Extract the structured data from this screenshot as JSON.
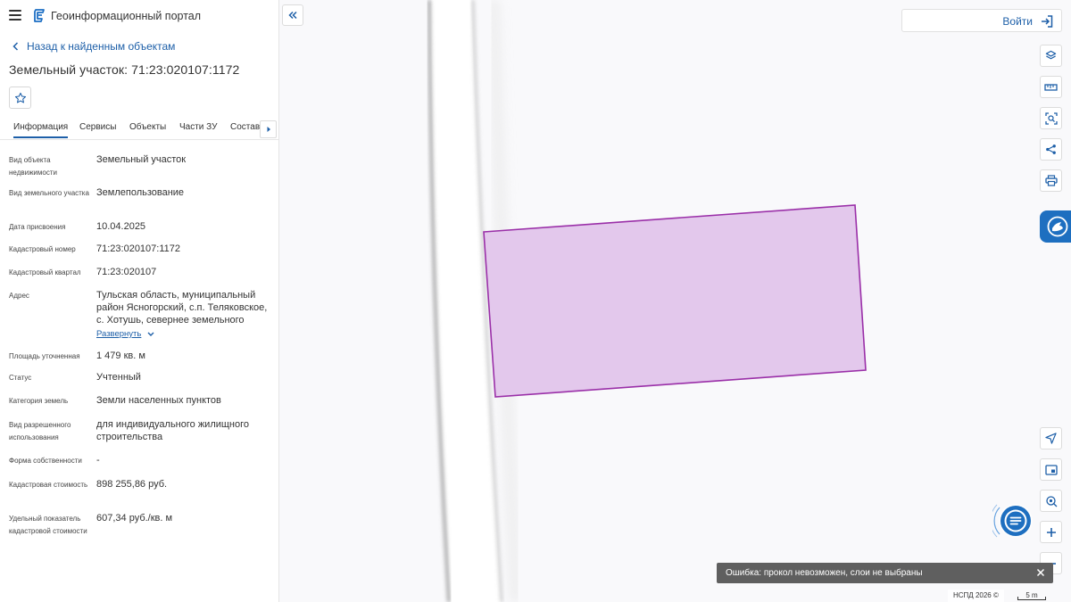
{
  "app": {
    "title": "Геоинформационный портал"
  },
  "nav": {
    "back_label": "Назад к найденным объектам"
  },
  "object": {
    "title": "Земельный участок: 71:23:020107:1172"
  },
  "tabs": [
    {
      "label": "Информация",
      "active": true
    },
    {
      "label": "Сервисы",
      "active": false
    },
    {
      "label": "Объекты",
      "active": false
    },
    {
      "label": "Части ЗУ",
      "active": false
    },
    {
      "label": "Состав",
      "active": false
    }
  ],
  "fields": [
    {
      "label": "Вид объекта недвижимости",
      "value": "Земельный участок"
    },
    {
      "label": "Вид земельного участка",
      "value": "Землепользование"
    },
    {
      "label": "Дата присвоения",
      "value": "10.04.2025"
    },
    {
      "label": "Кадастровый номер",
      "value": "71:23:020107:1172"
    },
    {
      "label": "Кадастровый квартал",
      "value": "71:23:020107"
    },
    {
      "label": "Адрес",
      "value": "Тульская область, муниципальный район Ясногорский, с.п. Теляковское, с. Хотушь, севернее земельного"
    },
    {
      "label": "Площадь уточненная",
      "value": "1 479 кв. м"
    },
    {
      "label": "Статус",
      "value": "Учтенный"
    },
    {
      "label": "Категория земель",
      "value": "Земли населенных пунктов"
    },
    {
      "label": "Вид разрешенного использования",
      "value": "для индивидуального жилищного строительства"
    },
    {
      "label": "Форма собственности",
      "value": "-"
    },
    {
      "label": "Кадастровая стоимость",
      "value": "898 255,86 руб."
    },
    {
      "label": "Удельный показатель кадастровой стоимости",
      "value": "607,34 руб./кв. м"
    }
  ],
  "address_expand_label": "Развернуть",
  "header": {
    "login_label": "Войти"
  },
  "toast": {
    "message": "Ошибка: прокол невозможен, слои не выбраны"
  },
  "map": {
    "copyright": "НСПД 2026 ©",
    "scale_label": "5 m",
    "parcel_fill": "#e3c8ec",
    "parcel_stroke": "#9a2fa8",
    "accent": "#1d5fa8",
    "assistant_color": "#1e6fc0"
  },
  "icons": {
    "menu": "hamburger-icon",
    "logo": "portal-logo-icon",
    "back": "chevron-left-icon",
    "favorite": "star-icon",
    "tabs_next": "caret-right-icon",
    "collapse": "double-chevron-left-icon",
    "login": "sign-in-icon",
    "layers": "layers-icon",
    "ruler": "ruler-icon",
    "select": "area-select-icon",
    "share": "share-icon",
    "print": "printer-icon",
    "locate": "navigation-arrow-icon",
    "minimap": "minimap-icon",
    "geolocation": "geolocation-icon",
    "zoom_in": "plus-icon",
    "zoom_out": "minus-icon",
    "chat": "chat-icon",
    "close": "close-icon"
  }
}
